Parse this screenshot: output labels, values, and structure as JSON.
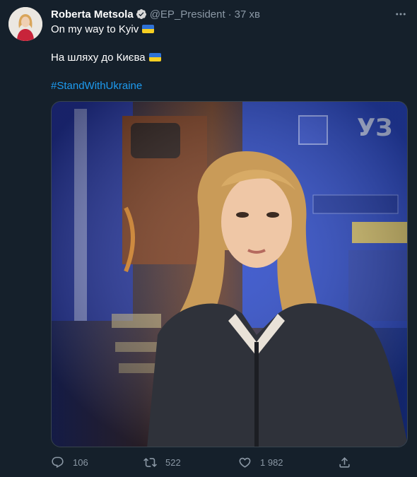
{
  "author": {
    "name": "Roberta Metsola",
    "handle": "@EP_President",
    "separator": "·",
    "time": "37 хв"
  },
  "icons": [
    "verified-badge-icon",
    "more-options-icon",
    "reply-icon",
    "retweet-icon",
    "like-icon",
    "share-icon"
  ],
  "body": {
    "line1": "On my way to Kyiv",
    "line2": "На шляху до Києва",
    "hashtag": "#StandWithUkraine"
  },
  "actions": {
    "replies": "106",
    "retweets": "522",
    "likes": "1 982"
  },
  "colors": {
    "background": "#15202b",
    "accent": "#1d9bf0",
    "muted": "#8b98a5",
    "flag_blue": "#2f72d6",
    "flag_yellow": "#f6cf22"
  }
}
